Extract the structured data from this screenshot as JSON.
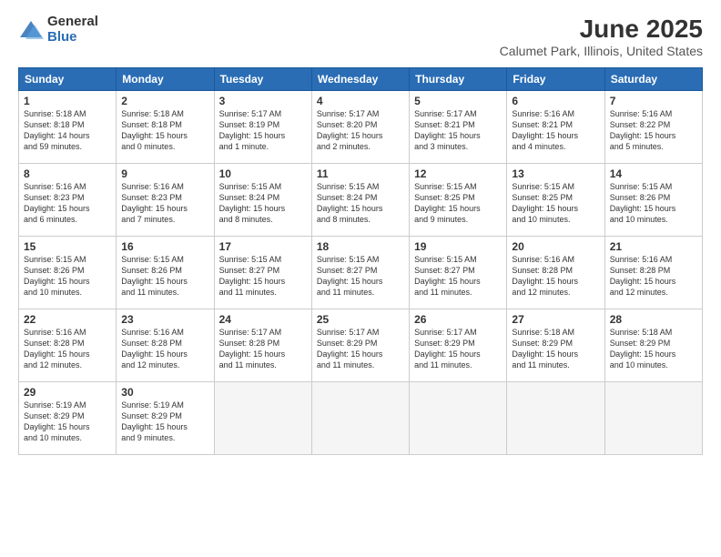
{
  "logo": {
    "general": "General",
    "blue": "Blue"
  },
  "title": "June 2025",
  "subtitle": "Calumet Park, Illinois, United States",
  "weekdays": [
    "Sunday",
    "Monday",
    "Tuesday",
    "Wednesday",
    "Thursday",
    "Friday",
    "Saturday"
  ],
  "weeks": [
    [
      {
        "day": "1",
        "info": "Sunrise: 5:18 AM\nSunset: 8:18 PM\nDaylight: 14 hours\nand 59 minutes."
      },
      {
        "day": "2",
        "info": "Sunrise: 5:18 AM\nSunset: 8:18 PM\nDaylight: 15 hours\nand 0 minutes."
      },
      {
        "day": "3",
        "info": "Sunrise: 5:17 AM\nSunset: 8:19 PM\nDaylight: 15 hours\nand 1 minute."
      },
      {
        "day": "4",
        "info": "Sunrise: 5:17 AM\nSunset: 8:20 PM\nDaylight: 15 hours\nand 2 minutes."
      },
      {
        "day": "5",
        "info": "Sunrise: 5:17 AM\nSunset: 8:21 PM\nDaylight: 15 hours\nand 3 minutes."
      },
      {
        "day": "6",
        "info": "Sunrise: 5:16 AM\nSunset: 8:21 PM\nDaylight: 15 hours\nand 4 minutes."
      },
      {
        "day": "7",
        "info": "Sunrise: 5:16 AM\nSunset: 8:22 PM\nDaylight: 15 hours\nand 5 minutes."
      }
    ],
    [
      {
        "day": "8",
        "info": "Sunrise: 5:16 AM\nSunset: 8:23 PM\nDaylight: 15 hours\nand 6 minutes."
      },
      {
        "day": "9",
        "info": "Sunrise: 5:16 AM\nSunset: 8:23 PM\nDaylight: 15 hours\nand 7 minutes."
      },
      {
        "day": "10",
        "info": "Sunrise: 5:15 AM\nSunset: 8:24 PM\nDaylight: 15 hours\nand 8 minutes."
      },
      {
        "day": "11",
        "info": "Sunrise: 5:15 AM\nSunset: 8:24 PM\nDaylight: 15 hours\nand 8 minutes."
      },
      {
        "day": "12",
        "info": "Sunrise: 5:15 AM\nSunset: 8:25 PM\nDaylight: 15 hours\nand 9 minutes."
      },
      {
        "day": "13",
        "info": "Sunrise: 5:15 AM\nSunset: 8:25 PM\nDaylight: 15 hours\nand 10 minutes."
      },
      {
        "day": "14",
        "info": "Sunrise: 5:15 AM\nSunset: 8:26 PM\nDaylight: 15 hours\nand 10 minutes."
      }
    ],
    [
      {
        "day": "15",
        "info": "Sunrise: 5:15 AM\nSunset: 8:26 PM\nDaylight: 15 hours\nand 10 minutes."
      },
      {
        "day": "16",
        "info": "Sunrise: 5:15 AM\nSunset: 8:26 PM\nDaylight: 15 hours\nand 11 minutes."
      },
      {
        "day": "17",
        "info": "Sunrise: 5:15 AM\nSunset: 8:27 PM\nDaylight: 15 hours\nand 11 minutes."
      },
      {
        "day": "18",
        "info": "Sunrise: 5:15 AM\nSunset: 8:27 PM\nDaylight: 15 hours\nand 11 minutes."
      },
      {
        "day": "19",
        "info": "Sunrise: 5:15 AM\nSunset: 8:27 PM\nDaylight: 15 hours\nand 11 minutes."
      },
      {
        "day": "20",
        "info": "Sunrise: 5:16 AM\nSunset: 8:28 PM\nDaylight: 15 hours\nand 12 minutes."
      },
      {
        "day": "21",
        "info": "Sunrise: 5:16 AM\nSunset: 8:28 PM\nDaylight: 15 hours\nand 12 minutes."
      }
    ],
    [
      {
        "day": "22",
        "info": "Sunrise: 5:16 AM\nSunset: 8:28 PM\nDaylight: 15 hours\nand 12 minutes."
      },
      {
        "day": "23",
        "info": "Sunrise: 5:16 AM\nSunset: 8:28 PM\nDaylight: 15 hours\nand 12 minutes."
      },
      {
        "day": "24",
        "info": "Sunrise: 5:17 AM\nSunset: 8:28 PM\nDaylight: 15 hours\nand 11 minutes."
      },
      {
        "day": "25",
        "info": "Sunrise: 5:17 AM\nSunset: 8:29 PM\nDaylight: 15 hours\nand 11 minutes."
      },
      {
        "day": "26",
        "info": "Sunrise: 5:17 AM\nSunset: 8:29 PM\nDaylight: 15 hours\nand 11 minutes."
      },
      {
        "day": "27",
        "info": "Sunrise: 5:18 AM\nSunset: 8:29 PM\nDaylight: 15 hours\nand 11 minutes."
      },
      {
        "day": "28",
        "info": "Sunrise: 5:18 AM\nSunset: 8:29 PM\nDaylight: 15 hours\nand 10 minutes."
      }
    ],
    [
      {
        "day": "29",
        "info": "Sunrise: 5:19 AM\nSunset: 8:29 PM\nDaylight: 15 hours\nand 10 minutes."
      },
      {
        "day": "30",
        "info": "Sunrise: 5:19 AM\nSunset: 8:29 PM\nDaylight: 15 hours\nand 9 minutes."
      },
      {
        "day": "",
        "info": ""
      },
      {
        "day": "",
        "info": ""
      },
      {
        "day": "",
        "info": ""
      },
      {
        "day": "",
        "info": ""
      },
      {
        "day": "",
        "info": ""
      }
    ]
  ]
}
